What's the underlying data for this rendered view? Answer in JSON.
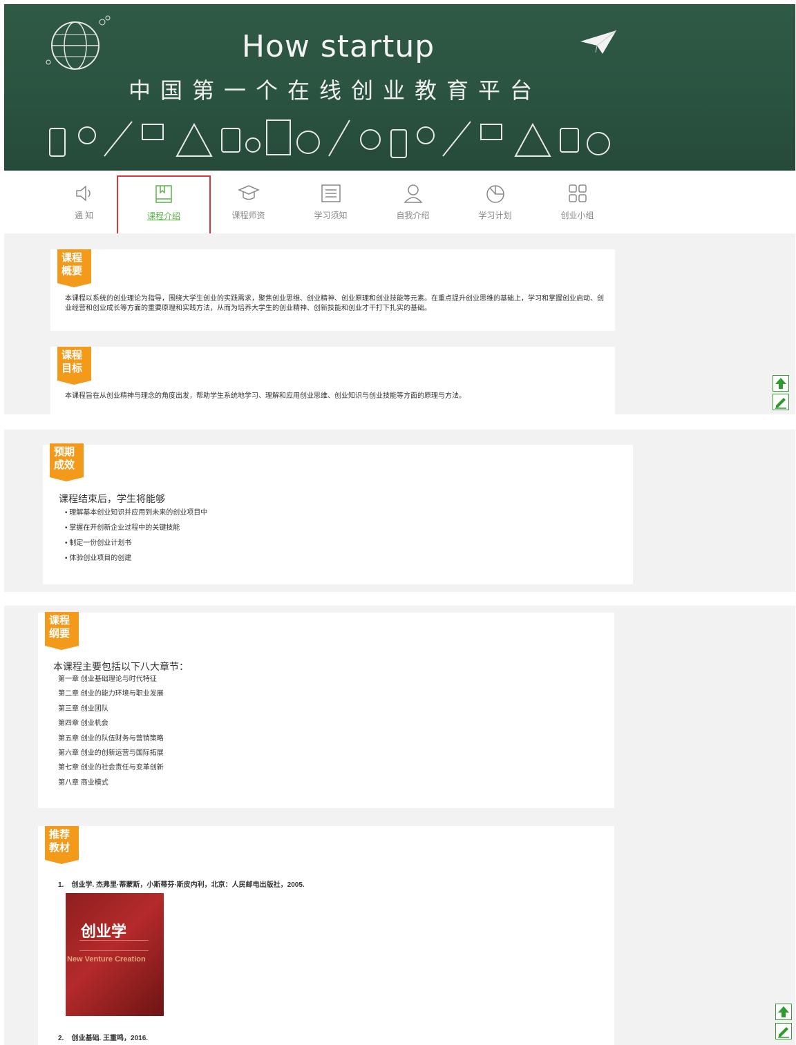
{
  "banner": {
    "title": "How startup",
    "subtitle": "中国第一个在线创业教育平台"
  },
  "nav": {
    "items": [
      {
        "label": "通 知",
        "icon": "speaker-icon"
      },
      {
        "label": "课程介绍",
        "icon": "book-icon",
        "active": true
      },
      {
        "label": "课程师资",
        "icon": "mortarboard-icon"
      },
      {
        "label": "学习须知",
        "icon": "list-icon"
      },
      {
        "label": "自我介绍",
        "icon": "user-icon"
      },
      {
        "label": "学习计划",
        "icon": "pie-chart-icon"
      },
      {
        "label": "创业小组",
        "icon": "grid-icon"
      }
    ]
  },
  "sections": {
    "overview": {
      "tag": [
        "课程",
        "概要"
      ],
      "text": "本课程以系统的创业理论为指导，围绕大学生创业的实践需求，聚焦创业思维、创业精神、创业原理和创业技能等元素。在重点提升创业思维的基础上，学习和掌握创业启动、创业经营和创业成长等方面的重要原理和实践方法，从而为培养大学生的创业精神、创新技能和创业才干打下扎实的基础。"
    },
    "goal": {
      "tag": [
        "课程",
        "目标"
      ],
      "text": "本课程旨在从创业精神与理念的角度出发，帮助学生系统地学习、理解和应用创业思维、创业知识与创业技能等方面的原理与方法。"
    },
    "outcome": {
      "tag": [
        "预期",
        "成效"
      ],
      "lead": "课程结束后，学生将能够",
      "items": [
        "理解基本创业知识并应用到未来的创业项目中",
        "掌握在开创新企业过程中的关键技能",
        "制定一份创业计划书",
        "体验创业项目的创建"
      ]
    },
    "syllabus": {
      "tag": [
        "课程",
        "纲要"
      ],
      "lead": "本课程主要包括以下八大章节：",
      "chapters": [
        "第一章 创业基础理论与时代特征",
        "第二章 创业的能力环境与职业发展",
        "第三章 创业团队",
        "第四章 创业机会",
        "第五章 创业的队伍财务与营销策略",
        "第六章 创业的创新运营与国际拓展",
        "第七章 创业的社会责任与变革创新",
        "第八章 商业模式"
      ]
    },
    "books": {
      "tag": [
        "推荐",
        "教材"
      ],
      "items": [
        {
          "index": "1.",
          "text": "创业学. 杰弗里·蒂蒙斯，小斯蒂芬·斯皮内利，北京：人民邮电出版社，2005."
        },
        {
          "index": "2.",
          "text": "创业基础. 王重鸣，2016."
        }
      ],
      "cover": {
        "title": "创业学",
        "subtitle": "New Venture Creation"
      }
    }
  },
  "side": {
    "icons": [
      "arrow-up-icon",
      "edit-icon"
    ]
  },
  "colors": {
    "banner_bg": "#2a5240",
    "accent": "#58b347",
    "tag": "#f39a1a",
    "active_outline": "#d93838"
  }
}
